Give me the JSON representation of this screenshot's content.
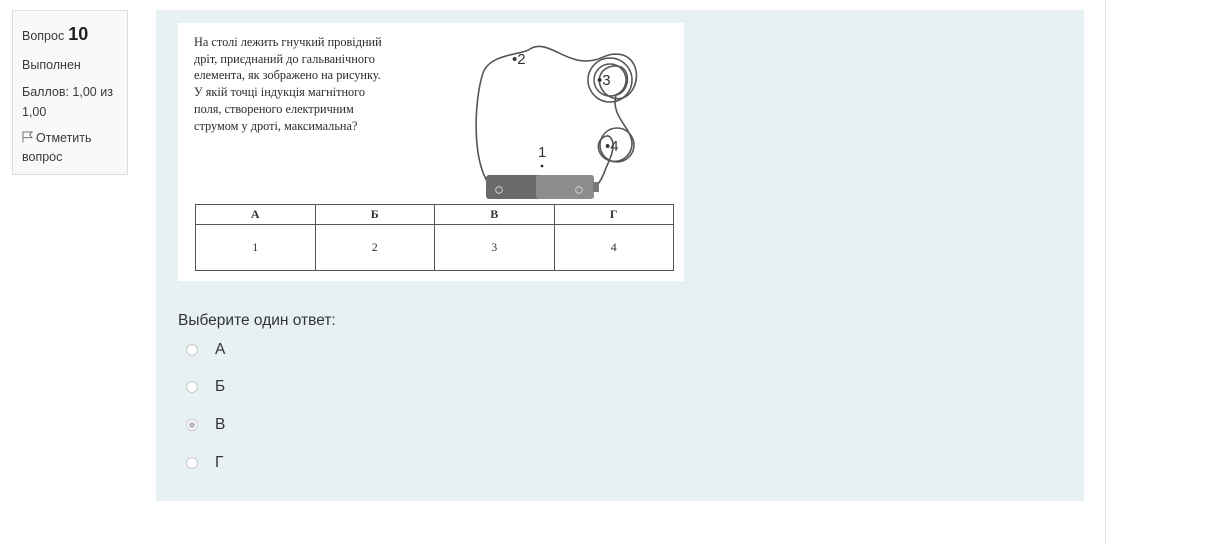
{
  "info": {
    "question_label": "Вопрос",
    "question_number": "10",
    "state": "Выполнен",
    "grade": "Баллов: 1,00 из 1,00",
    "flag_label": "Отметить вопрос"
  },
  "question": {
    "text_lines": [
      "На столі лежить гнучкий провідний",
      "дріт, приєднаний до гальванічного",
      "елемента, як зображено на рисунку.",
      "У якій точці індукція магнітного",
      "поля, створеного електричним",
      "струмом у дроті, максимальна?"
    ],
    "figure_labels": {
      "p1": "1",
      "p2": "•2",
      "p3": "•3",
      "p4": "•4"
    },
    "table": {
      "headers": [
        "А",
        "Б",
        "В",
        "Г"
      ],
      "values": [
        "1",
        "2",
        "3",
        "4"
      ]
    }
  },
  "prompt": "Выберите один ответ:",
  "options": [
    {
      "label": "А",
      "selected": false
    },
    {
      "label": "Б",
      "selected": false
    },
    {
      "label": "В",
      "selected": true
    },
    {
      "label": "Г",
      "selected": false
    }
  ]
}
